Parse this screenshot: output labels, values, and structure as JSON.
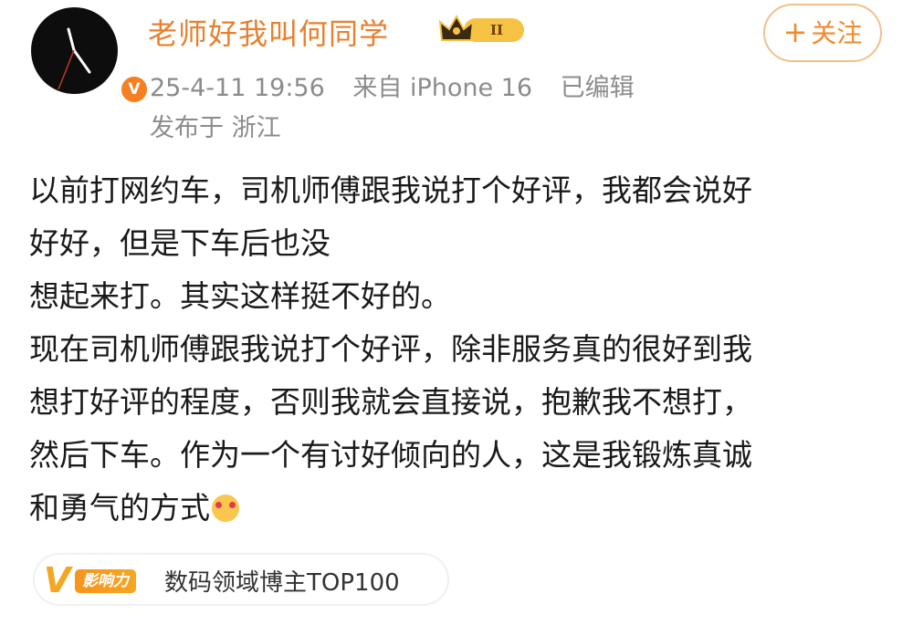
{
  "user": {
    "name": "老师好我叫何同学",
    "vip_level": "II",
    "follow_label": "关注",
    "follow_icon": "plus-icon"
  },
  "meta": {
    "time": "25-4-11 19:56",
    "source": "来自 iPhone 16",
    "edited": "已编辑",
    "location": "发布于 浙江"
  },
  "post": {
    "lines": [
      "以前打网约车，司机师傅跟我说打个好评，我都会说好",
      "好好，但是下车后也没",
      "想起来打。其实这样挺不好的。",
      "现在司机师傅跟我说打个好评，除非服务真的很好到我",
      "想打好评的程度，否则我就会直接说，抱歉我不想打，",
      "然后下车。作为一个有讨好倾向的人，这是我锻炼真诚",
      "和勇气的方式"
    ],
    "emoji": "heart-eyes-emoji"
  },
  "influence": {
    "logo_letter": "V",
    "logo_tag": "影响力",
    "text": "数码领域博主TOP100"
  },
  "colors": {
    "accent_orange": "#e8802e",
    "meta_gray": "#8c8c8c",
    "verify_orange": "#f57f21"
  }
}
